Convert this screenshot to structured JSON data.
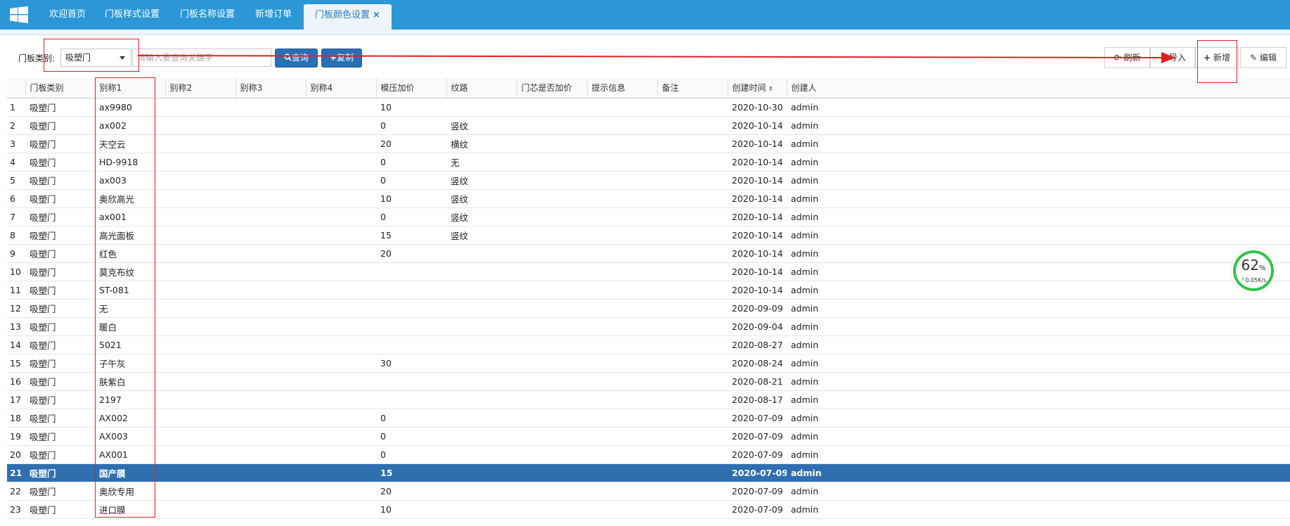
{
  "tabs": [
    {
      "label": "欢迎首页"
    },
    {
      "label": "门板样式设置"
    },
    {
      "label": "门板名称设置"
    },
    {
      "label": "新增订单"
    },
    {
      "label": "门板颜色设置"
    }
  ],
  "tab_close": "×",
  "filter": {
    "label": "门板类别:",
    "selected": "吸塑门",
    "search_placeholder": "请输入要查询关键字"
  },
  "buttons": {
    "query": "查询",
    "copy": "复制",
    "refresh": "刷新",
    "import": "导入",
    "add": "新增",
    "edit": "编辑"
  },
  "widget": {
    "percent": "62",
    "unit": "%",
    "rate": "0.05K/s"
  },
  "table": {
    "headers": [
      "门板类别",
      "别称1",
      "别称2",
      "别称3",
      "别称4",
      "模压加价",
      "纹路",
      "门芯是否加价",
      "提示信息",
      "备注",
      "创建时间",
      "创建人"
    ],
    "rows": [
      {
        "n": "1",
        "cat": "吸塑门",
        "a1": "ax9980",
        "price": "10",
        "grain": "",
        "time": "2020-10-30",
        "by": "admin"
      },
      {
        "n": "2",
        "cat": "吸塑门",
        "a1": "ax002",
        "price": "0",
        "grain": "竖纹",
        "time": "2020-10-14",
        "by": "admin"
      },
      {
        "n": "3",
        "cat": "吸塑门",
        "a1": "天空云",
        "price": "20",
        "grain": "横纹",
        "time": "2020-10-14",
        "by": "admin"
      },
      {
        "n": "4",
        "cat": "吸塑门",
        "a1": "HD-9918",
        "price": "0",
        "grain": "无",
        "time": "2020-10-14",
        "by": "admin"
      },
      {
        "n": "5",
        "cat": "吸塑门",
        "a1": "ax003",
        "price": "0",
        "grain": "竖纹",
        "time": "2020-10-14",
        "by": "admin"
      },
      {
        "n": "6",
        "cat": "吸塑门",
        "a1": "奥欣高光",
        "price": "10",
        "grain": "竖纹",
        "time": "2020-10-14",
        "by": "admin"
      },
      {
        "n": "7",
        "cat": "吸塑门",
        "a1": "ax001",
        "price": "0",
        "grain": "竖纹",
        "time": "2020-10-14",
        "by": "admin"
      },
      {
        "n": "8",
        "cat": "吸塑门",
        "a1": "高光面板",
        "price": "15",
        "grain": "竖纹",
        "time": "2020-10-14",
        "by": "admin"
      },
      {
        "n": "9",
        "cat": "吸塑门",
        "a1": "红色",
        "price": "20",
        "grain": "",
        "time": "2020-10-14",
        "by": "admin"
      },
      {
        "n": "10",
        "cat": "吸塑门",
        "a1": "莫克布纹",
        "price": "",
        "grain": "",
        "time": "2020-10-14",
        "by": "admin"
      },
      {
        "n": "11",
        "cat": "吸塑门",
        "a1": "ST-081",
        "price": "",
        "grain": "",
        "time": "2020-10-14",
        "by": "admin"
      },
      {
        "n": "12",
        "cat": "吸塑门",
        "a1": "无",
        "price": "",
        "grain": "",
        "time": "2020-09-09",
        "by": "admin"
      },
      {
        "n": "13",
        "cat": "吸塑门",
        "a1": "暖白",
        "price": "",
        "grain": "",
        "time": "2020-09-04",
        "by": "admin"
      },
      {
        "n": "14",
        "cat": "吸塑门",
        "a1": "5021",
        "price": "",
        "grain": "",
        "time": "2020-08-27",
        "by": "admin"
      },
      {
        "n": "15",
        "cat": "吸塑门",
        "a1": "子午灰",
        "price": "30",
        "grain": "",
        "time": "2020-08-24",
        "by": "admin"
      },
      {
        "n": "16",
        "cat": "吸塑门",
        "a1": "肤紫白",
        "price": "",
        "grain": "",
        "time": "2020-08-21",
        "by": "admin"
      },
      {
        "n": "17",
        "cat": "吸塑门",
        "a1": "2197",
        "price": "",
        "grain": "",
        "time": "2020-08-17",
        "by": "admin"
      },
      {
        "n": "18",
        "cat": "吸塑门",
        "a1": "AX002",
        "price": "0",
        "grain": "",
        "time": "2020-07-09",
        "by": "admin"
      },
      {
        "n": "19",
        "cat": "吸塑门",
        "a1": "AX003",
        "price": "0",
        "grain": "",
        "time": "2020-07-09",
        "by": "admin"
      },
      {
        "n": "20",
        "cat": "吸塑门",
        "a1": "AX001",
        "price": "0",
        "grain": "",
        "time": "2020-07-09",
        "by": "admin"
      },
      {
        "n": "21",
        "cat": "吸塑门",
        "a1": "国产膜",
        "price": "15",
        "grain": "",
        "time": "2020-07-09",
        "by": "admin",
        "selected": true
      },
      {
        "n": "22",
        "cat": "吸塑门",
        "a1": "奥欣专用",
        "price": "20",
        "grain": "",
        "time": "2020-07-09",
        "by": "admin"
      },
      {
        "n": "23",
        "cat": "吸塑门",
        "a1": "进口膜",
        "price": "10",
        "grain": "",
        "time": "2020-07-09",
        "by": "admin"
      }
    ]
  },
  "colors": {
    "topbar": "#2b97d6",
    "selected_row": "#2f6fb0",
    "button": "#2a6fb5",
    "annotation": "#e02020"
  }
}
